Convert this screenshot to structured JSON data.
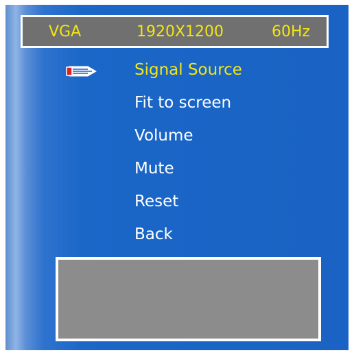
{
  "status": {
    "input": "VGA",
    "resolution": "1920X1200",
    "refresh_rate": "60Hz"
  },
  "menu": {
    "selected_index": 0,
    "items": [
      {
        "label": "Signal Source"
      },
      {
        "label": "Fit to screen"
      },
      {
        "label": "Volume"
      },
      {
        "label": "Mute"
      },
      {
        "label": "Reset"
      },
      {
        "label": "Back"
      }
    ]
  },
  "colors": {
    "highlight": "#f2e614",
    "text": "#ffffff",
    "status_bar": "#707070",
    "info_box": "#8c8c8c",
    "pointer_tip": "#e02020"
  },
  "icons": {
    "selection_pointer": "pencil-pointer-icon"
  }
}
